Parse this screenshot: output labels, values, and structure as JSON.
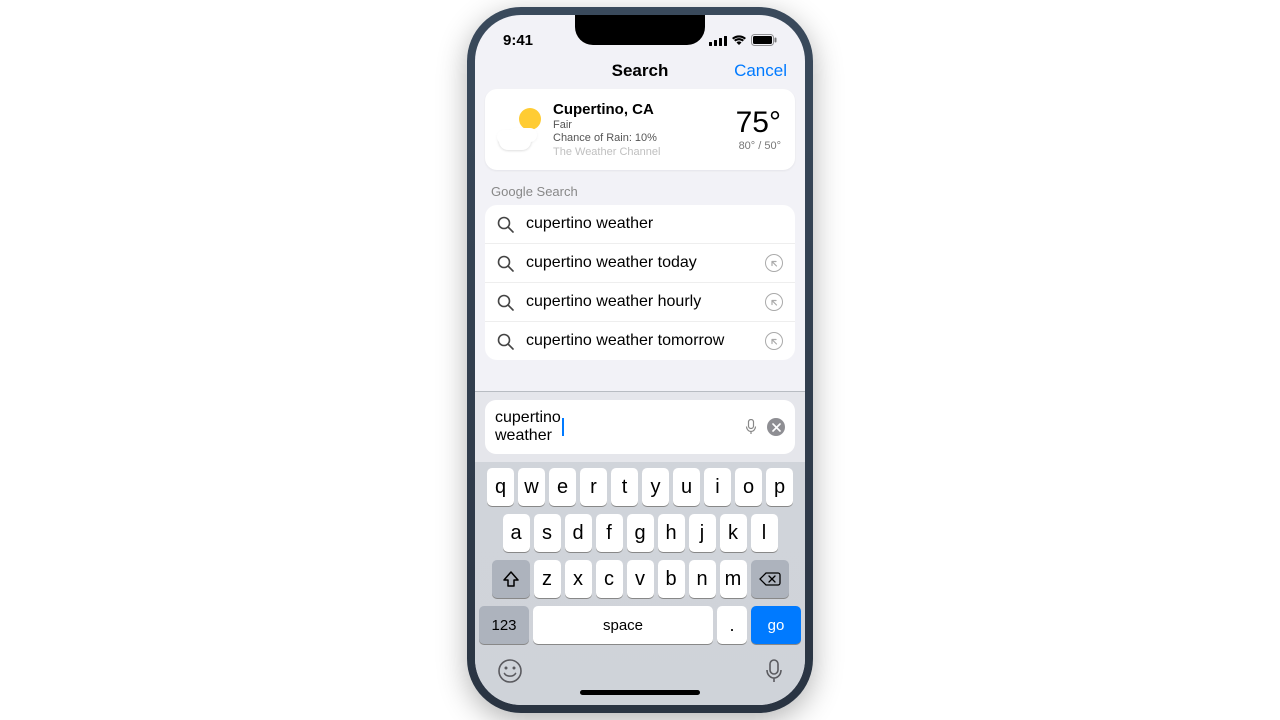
{
  "status": {
    "time": "9:41"
  },
  "nav": {
    "title": "Search",
    "cancel": "Cancel"
  },
  "weather": {
    "location": "Cupertino, CA",
    "condition": "Fair",
    "rain": "Chance of Rain: 10%",
    "source": "The Weather Channel",
    "temp": "75°",
    "range": "80° / 50°"
  },
  "section_label": "Google Search",
  "suggestions": [
    {
      "q": "cupertino weather",
      "arrow": false
    },
    {
      "q": "cupertino weather today",
      "arrow": true
    },
    {
      "q": "cupertino weather hourly",
      "arrow": true
    },
    {
      "q": "cupertino weather tomorrow",
      "arrow": true
    }
  ],
  "search_text": "cupertino weather",
  "keyboard": {
    "row1": [
      "q",
      "w",
      "e",
      "r",
      "t",
      "y",
      "u",
      "i",
      "o",
      "p"
    ],
    "row2": [
      "a",
      "s",
      "d",
      "f",
      "g",
      "h",
      "j",
      "k",
      "l"
    ],
    "row3": [
      "z",
      "x",
      "c",
      "v",
      "b",
      "n",
      "m"
    ],
    "numbers": "123",
    "space": "space",
    "period": ".",
    "go": "go"
  }
}
